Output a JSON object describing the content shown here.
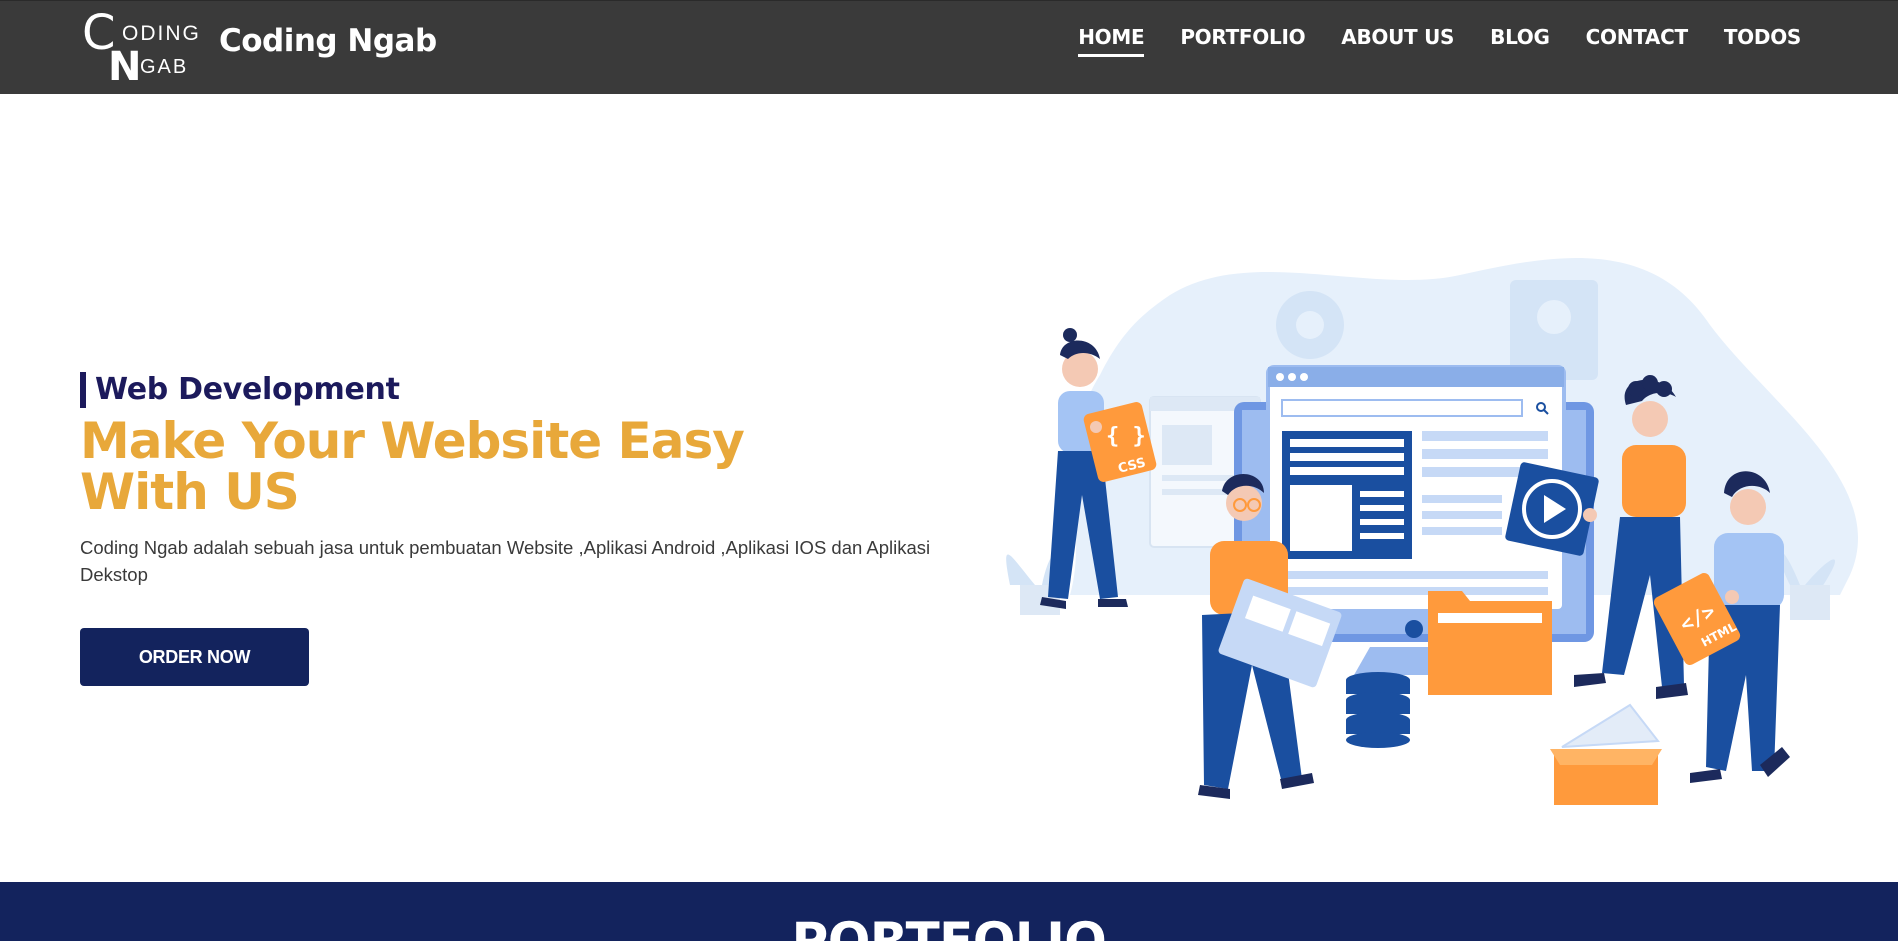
{
  "brand": {
    "logo_letters": [
      "C",
      "ODING",
      "N",
      "GAB"
    ],
    "name": "Coding Ngab"
  },
  "nav": {
    "items": [
      "HOME",
      "PORTFOLIO",
      "ABOUT US",
      "BLOG",
      "CONTACT",
      "TODOS"
    ],
    "active": "HOME"
  },
  "hero": {
    "subtitle": "Web Development",
    "title_line1": "Make Your Website Easy",
    "title_line2": "With US",
    "description": "Coding Ngab adalah sebuah jasa untuk pembuatan Website ,Aplikasi Android ,Aplikasi IOS dan Aplikasi Dekstop",
    "cta_label": "ORDER NOW"
  },
  "illustration": {
    "badges": [
      "CSS",
      "HTML"
    ],
    "brackets": "{ }",
    "code_glyph": "</>"
  },
  "portfolio": {
    "heading": "PORTFOLIO"
  },
  "colors": {
    "header_bg": "#3a3a3a",
    "accent_gold": "#e8a83a",
    "navy": "#13235d",
    "subtitle_navy": "#1c1a5c",
    "orange": "#ff9a3c",
    "blue": "#1a4fa0"
  }
}
